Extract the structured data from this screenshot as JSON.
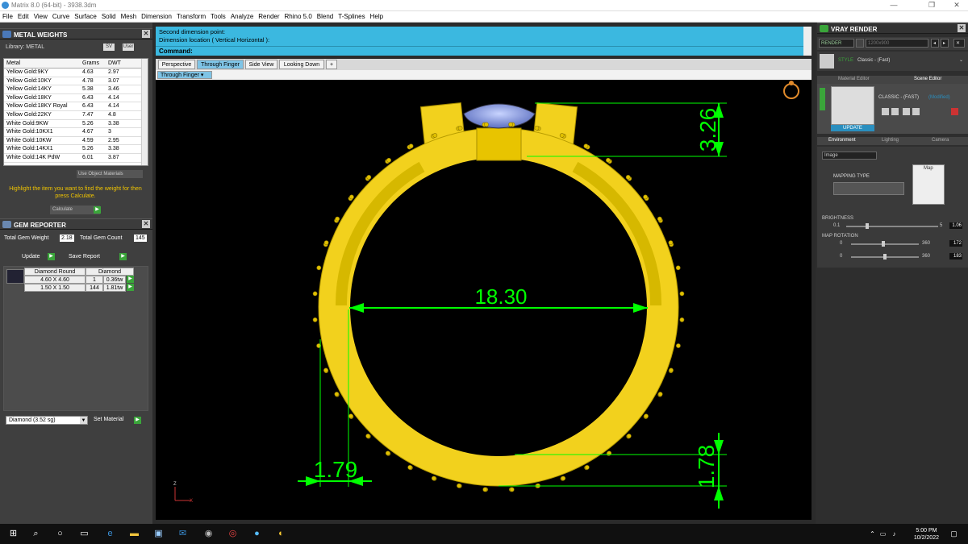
{
  "window": {
    "title": "Matrix 8.0 (64-bit) - 3938.3dm"
  },
  "menu": [
    "File",
    "Edit",
    "View",
    "Curve",
    "Surface",
    "Solid",
    "Mesh",
    "Dimension",
    "Transform",
    "Tools",
    "Analyze",
    "Render",
    "Rhino 5.0",
    "Blend",
    "T-Splines",
    "Help"
  ],
  "metal_weights": {
    "title": "METAL WEIGHTS",
    "library_label": "Library: METAL",
    "buttons": [
      "SV",
      "User"
    ],
    "columns": [
      "Metal",
      "Grams",
      "DWT"
    ],
    "rows": [
      [
        "Yellow Gold:9KY",
        "4.63",
        "2.97"
      ],
      [
        "Yellow Gold:10KY",
        "4.78",
        "3.07"
      ],
      [
        "Yellow Gold:14KY",
        "5.38",
        "3.46"
      ],
      [
        "Yellow Gold:18KY",
        "6.43",
        "4.14"
      ],
      [
        "Yellow Gold:18KY Royal",
        "6.43",
        "4.14"
      ],
      [
        "Yellow Gold:22KY",
        "7.47",
        "4.8"
      ],
      [
        "White Gold:9KW",
        "5.26",
        "3.38"
      ],
      [
        "White Gold:10KX1",
        "4.67",
        "3"
      ],
      [
        "White Gold:10KW",
        "4.59",
        "2.95"
      ],
      [
        "White Gold:14KX1",
        "5.26",
        "3.38"
      ],
      [
        "White Gold:14K PdW",
        "6.01",
        "3.87"
      ]
    ],
    "use_object": "Use Object Materials",
    "hint": "Highlight the item you want to find the weight for then press Calculate.",
    "calculate": "Calculate"
  },
  "gem_reporter": {
    "title": "GEM REPORTER",
    "total_weight_label": "Total Gem Weight",
    "total_weight": "2.18",
    "total_count_label": "Total Gem Count",
    "total_count": "145",
    "update": "Update",
    "save_report": "Save Report",
    "header": [
      "Diamond Round",
      "Diamond"
    ],
    "rows": [
      [
        "4.60 X 4.60",
        "1",
        "0.36tw"
      ],
      [
        "1.50 X 1.50",
        "144",
        "1.81tw"
      ]
    ],
    "material": "Diamond   (3.52 sg)",
    "set_material": "Set Material"
  },
  "command": {
    "line1": "Second dimension point:",
    "line2": "Dimension location ( Vertical  Horizontal ):",
    "prompt": "Command:"
  },
  "tabs": [
    "Perspective",
    "Through Finger",
    "Side View",
    "Looking Down"
  ],
  "active_tab": "Through Finger",
  "viewport_label": "Through Finger",
  "dimensions": {
    "inner_diameter": "18.30",
    "top_height": "3.26",
    "shank_width": "1.79",
    "bottom_thickness": "1.78"
  },
  "axis": {
    "z": "Z",
    "x": "X"
  },
  "vray": {
    "title": "VRAY RENDER",
    "render": "RENDER",
    "resolution": "1200x900",
    "style_label": "STYLE",
    "style_value": "Classic - (Fast)",
    "tab_material": "Material Editor",
    "tab_scene": "Scene Editor",
    "material_name": "CLASSIC - (FAST)",
    "modified": "(Modified)",
    "update": "UPDATE",
    "env_tabs": [
      "Environment",
      "Lighting",
      "Camera"
    ],
    "env_type": "Image",
    "mapping_type": "MAPPING TYPE",
    "map": "Map",
    "brightness_label": "BRIGHTNESS",
    "brightness_min": "0.1",
    "brightness_max": "5",
    "brightness": "1.06",
    "map_rotation_label": "MAP ROTATION",
    "rot_min": "0",
    "rot_max": "360",
    "rotation1": "172",
    "rotation2": "183"
  },
  "taskbar": {
    "time": "5:00 PM",
    "date": "10/2/2022"
  },
  "colors": {
    "accent_blue": "#3bb8e0",
    "gold": "#f2d11d",
    "dim_green": "#00ff00",
    "hint_yellow": "#f0c400"
  }
}
